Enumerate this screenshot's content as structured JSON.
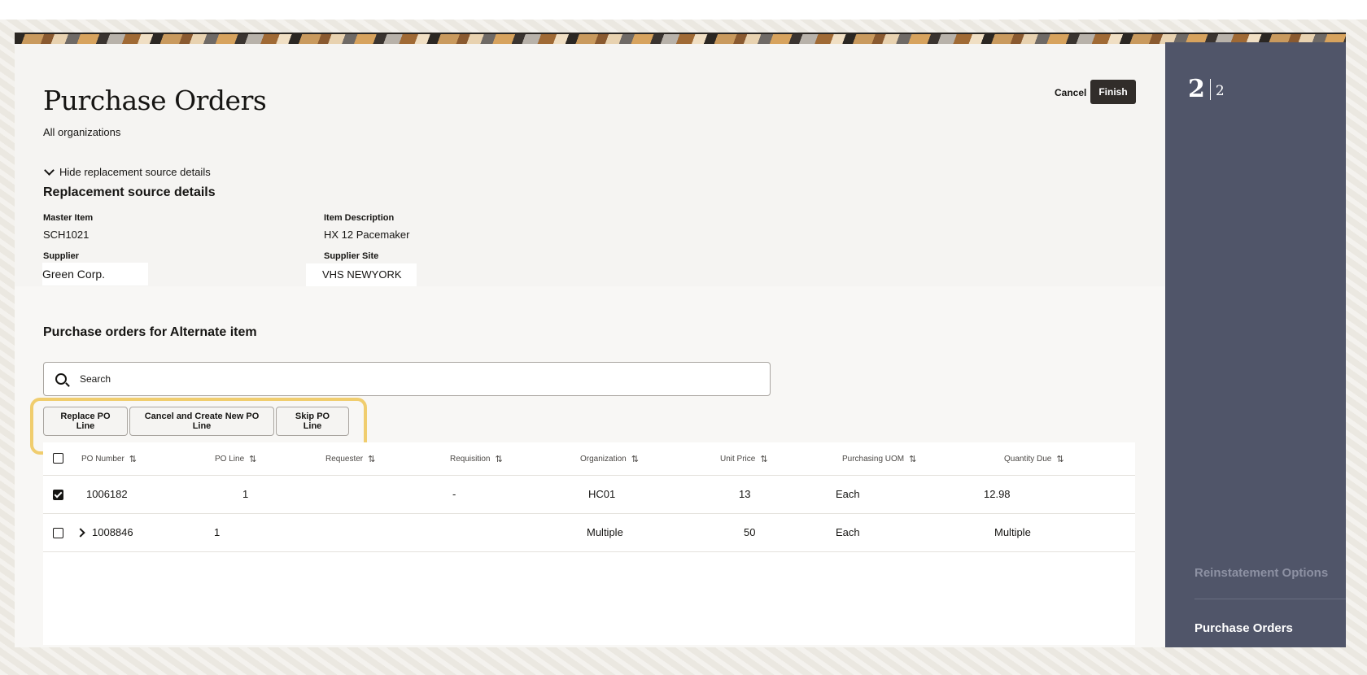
{
  "page": {
    "title": "Purchase Orders",
    "subtitle": "All organizations"
  },
  "header_actions": {
    "cancel_label": "Cancel",
    "finish_label": "Finish"
  },
  "details": {
    "toggle_label": "Hide replacement source details",
    "section_title": "Replacement source details",
    "master_item_label": "Master Item",
    "master_item_value": "SCH1021",
    "item_description_label": "Item Description",
    "item_description_value": "HX 12 Pacemaker",
    "supplier_label": "Supplier",
    "supplier_value": "Green Corp.",
    "supplier_site_label": "Supplier Site",
    "supplier_site_value": "VHS NEWYORK"
  },
  "po_section": {
    "title": "Purchase orders for Alternate item",
    "search_placeholder": "Search",
    "actions": {
      "replace": "Replace PO Line",
      "cancel_create": "Cancel and Create New PO Line",
      "skip": "Skip PO Line"
    }
  },
  "table": {
    "columns": [
      "PO Number",
      "PO Line",
      "Requester",
      "Requisition",
      "Organization",
      "Unit Price",
      "Purchasing UOM",
      "Quantity Due"
    ],
    "rows": [
      {
        "checked": true,
        "expandable": false,
        "po_number": "1006182",
        "po_line": "1",
        "requester": "",
        "requisition": "-",
        "organization": "HC01",
        "unit_price": "13",
        "uom": "Each",
        "quantity_due": "12.98"
      },
      {
        "checked": false,
        "expandable": true,
        "po_number": "1008846",
        "po_line": "1",
        "requester": "",
        "requisition": "",
        "organization": "Multiple",
        "unit_price": "50",
        "uom": "Each",
        "quantity_due": "Multiple"
      }
    ]
  },
  "sidebar": {
    "step_current": "2",
    "step_total": "2",
    "steps": [
      "Reinstatement Options",
      "Purchase Orders"
    ]
  },
  "colors": {
    "sidebar_bg": "#505569",
    "finish_bg": "#312d2a",
    "highlight": "#f0cd6e"
  }
}
